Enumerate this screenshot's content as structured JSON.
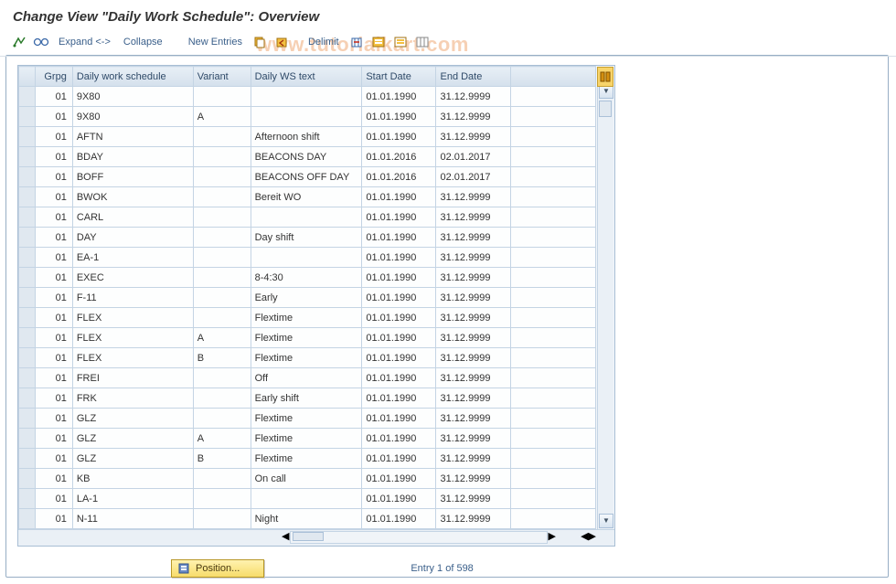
{
  "title": "Change View \"Daily Work Schedule\": Overview",
  "watermark": "www.tutorialkart.com",
  "toolbar": {
    "expand": "Expand <->",
    "collapse": "Collapse",
    "new_entries": "New Entries",
    "delimit": "Delimit"
  },
  "columns": {
    "grpg": "Grpg",
    "dws": "Daily work schedule",
    "variant": "Variant",
    "text": "Daily WS text",
    "start": "Start Date",
    "end": "End Date"
  },
  "rows": [
    {
      "grpg": "01",
      "dws": "9X80",
      "variant": "",
      "text": "",
      "start": "01.01.1990",
      "end": "31.12.9999"
    },
    {
      "grpg": "01",
      "dws": "9X80",
      "variant": "A",
      "text": "",
      "start": "01.01.1990",
      "end": "31.12.9999"
    },
    {
      "grpg": "01",
      "dws": "AFTN",
      "variant": "",
      "text": "Afternoon shift",
      "start": "01.01.1990",
      "end": "31.12.9999"
    },
    {
      "grpg": "01",
      "dws": "BDAY",
      "variant": "",
      "text": "BEACONS DAY",
      "start": "01.01.2016",
      "end": "02.01.2017"
    },
    {
      "grpg": "01",
      "dws": "BOFF",
      "variant": "",
      "text": "BEACONS OFF DAY",
      "start": "01.01.2016",
      "end": "02.01.2017"
    },
    {
      "grpg": "01",
      "dws": "BWOK",
      "variant": "",
      "text": "Bereit WO",
      "start": "01.01.1990",
      "end": "31.12.9999"
    },
    {
      "grpg": "01",
      "dws": "CARL",
      "variant": "",
      "text": "",
      "start": "01.01.1990",
      "end": "31.12.9999"
    },
    {
      "grpg": "01",
      "dws": "DAY",
      "variant": "",
      "text": "Day shift",
      "start": "01.01.1990",
      "end": "31.12.9999"
    },
    {
      "grpg": "01",
      "dws": "EA-1",
      "variant": "",
      "text": "",
      "start": "01.01.1990",
      "end": "31.12.9999"
    },
    {
      "grpg": "01",
      "dws": "EXEC",
      "variant": "",
      "text": "8-4:30",
      "start": "01.01.1990",
      "end": "31.12.9999"
    },
    {
      "grpg": "01",
      "dws": "F-11",
      "variant": "",
      "text": "Early",
      "start": "01.01.1990",
      "end": "31.12.9999"
    },
    {
      "grpg": "01",
      "dws": "FLEX",
      "variant": "",
      "text": "Flextime",
      "start": "01.01.1990",
      "end": "31.12.9999"
    },
    {
      "grpg": "01",
      "dws": "FLEX",
      "variant": "A",
      "text": "Flextime",
      "start": "01.01.1990",
      "end": "31.12.9999"
    },
    {
      "grpg": "01",
      "dws": "FLEX",
      "variant": "B",
      "text": "Flextime",
      "start": "01.01.1990",
      "end": "31.12.9999"
    },
    {
      "grpg": "01",
      "dws": "FREI",
      "variant": "",
      "text": "Off",
      "start": "01.01.1990",
      "end": "31.12.9999"
    },
    {
      "grpg": "01",
      "dws": "FRK",
      "variant": "",
      "text": "Early shift",
      "start": "01.01.1990",
      "end": "31.12.9999"
    },
    {
      "grpg": "01",
      "dws": "GLZ",
      "variant": "",
      "text": "Flextime",
      "start": "01.01.1990",
      "end": "31.12.9999"
    },
    {
      "grpg": "01",
      "dws": "GLZ",
      "variant": "A",
      "text": "Flextime",
      "start": "01.01.1990",
      "end": "31.12.9999"
    },
    {
      "grpg": "01",
      "dws": "GLZ",
      "variant": "B",
      "text": "Flextime",
      "start": "01.01.1990",
      "end": "31.12.9999"
    },
    {
      "grpg": "01",
      "dws": "KB",
      "variant": "",
      "text": "On call",
      "start": "01.01.1990",
      "end": "31.12.9999"
    },
    {
      "grpg": "01",
      "dws": "LA-1",
      "variant": "",
      "text": "",
      "start": "01.01.1990",
      "end": "31.12.9999"
    },
    {
      "grpg": "01",
      "dws": "N-11",
      "variant": "",
      "text": "Night",
      "start": "01.01.1990",
      "end": "31.12.9999"
    }
  ],
  "footer": {
    "position_btn": "Position...",
    "entry_text": "Entry 1 of 598"
  }
}
